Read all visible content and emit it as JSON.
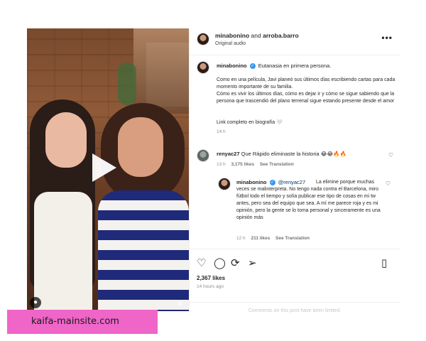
{
  "header": {
    "user1": "minabonino",
    "joiner": "and",
    "user2": "arroba.barro",
    "subtitle": "Original audio"
  },
  "caption": {
    "username": "minabonino",
    "title_line": "Eutanasia en primera persona.",
    "para1": "Como en una película, Javi planeó sus últimos días escribiendo cartas para cada momento importante de su familia.",
    "para2": "Cómo es vivir los últimos días, cómo es dejar ir y cómo se sigue sabiendo que la persona que trascendió del plano terrenal sigue estando presente desde el amor",
    "link_line": "Link completo en biografía 🤍",
    "time": "14 h"
  },
  "comment1": {
    "username": "renyac27",
    "text": "Que Rápido eliminaste la historia 😂😂🔥🔥",
    "time": "13 h",
    "likes": "3,175 likes",
    "translation": "See Translation"
  },
  "reply": {
    "username": "minabonino",
    "mention": "@renyac27",
    "text": "La elimine porque muchas veces se malinterpreta. No tengo nada contra el Barcelona, miro fútbol todo el tiempo y solía publicar ese tipo de cosas en mi tw antes, pero sea del equipo que sea. A mí me parece roja y es mi opinión, pero la gente se lo toma personal y sinceramente es una opinión más",
    "time": "12 h",
    "likes": "211 likes",
    "translation": "See Translation"
  },
  "post": {
    "likes": "2,367 likes",
    "ago": "14 hours ago",
    "limited": "Comments on this post have been limited."
  },
  "watermark": {
    "text": "kaifa-mainsite.com"
  },
  "colors": {
    "verified": "#3897f0",
    "watermark": "#ef65c8",
    "stripe_blue": "#1f2a7a"
  },
  "icons": [
    "play-icon",
    "more-icon",
    "heart-icon",
    "comment-icon",
    "repost-icon",
    "share-icon",
    "bookmark-icon",
    "verified-icon"
  ]
}
